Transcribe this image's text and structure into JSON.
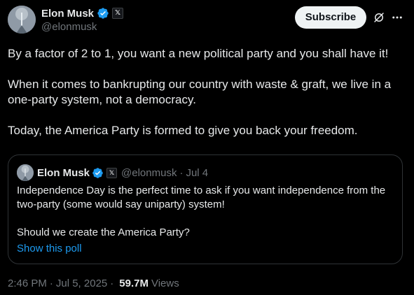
{
  "author": {
    "name": "Elon Musk",
    "handle": "@elonmusk",
    "affiliate_badge": "𝕏",
    "verified_color": "#1d9bf0"
  },
  "header": {
    "subscribe_label": "Subscribe",
    "grok_icon": "grok-icon",
    "more_icon": "more-icon"
  },
  "tweet": {
    "paragraphs": [
      "By a factor of 2 to 1, you want a new political party and you shall have it!",
      "When it comes to bankrupting our country with waste & graft, we live in a one-party system, not a democracy.",
      "Today, the America Party is formed to give you back your freedom."
    ]
  },
  "quote": {
    "name": "Elon Musk",
    "affiliate_badge": "𝕏",
    "handle": "@elonmusk",
    "separator": "·",
    "date": "Jul 4",
    "paragraphs": [
      "Independence Day is the perfect time to ask if you want independence from the two-party (some would say uniparty) system!",
      "Should we create the America Party?"
    ],
    "poll_link": "Show this poll"
  },
  "meta": {
    "time": "2:46 PM",
    "dot1": "·",
    "date": "Jul 5, 2025",
    "dot2": "·",
    "views_count": "59.7M",
    "views_label": "Views"
  },
  "colors": {
    "background": "#000000",
    "text": "#e7e9ea",
    "muted": "#71767b",
    "link": "#1d9bf0",
    "border": "#2f3336"
  }
}
